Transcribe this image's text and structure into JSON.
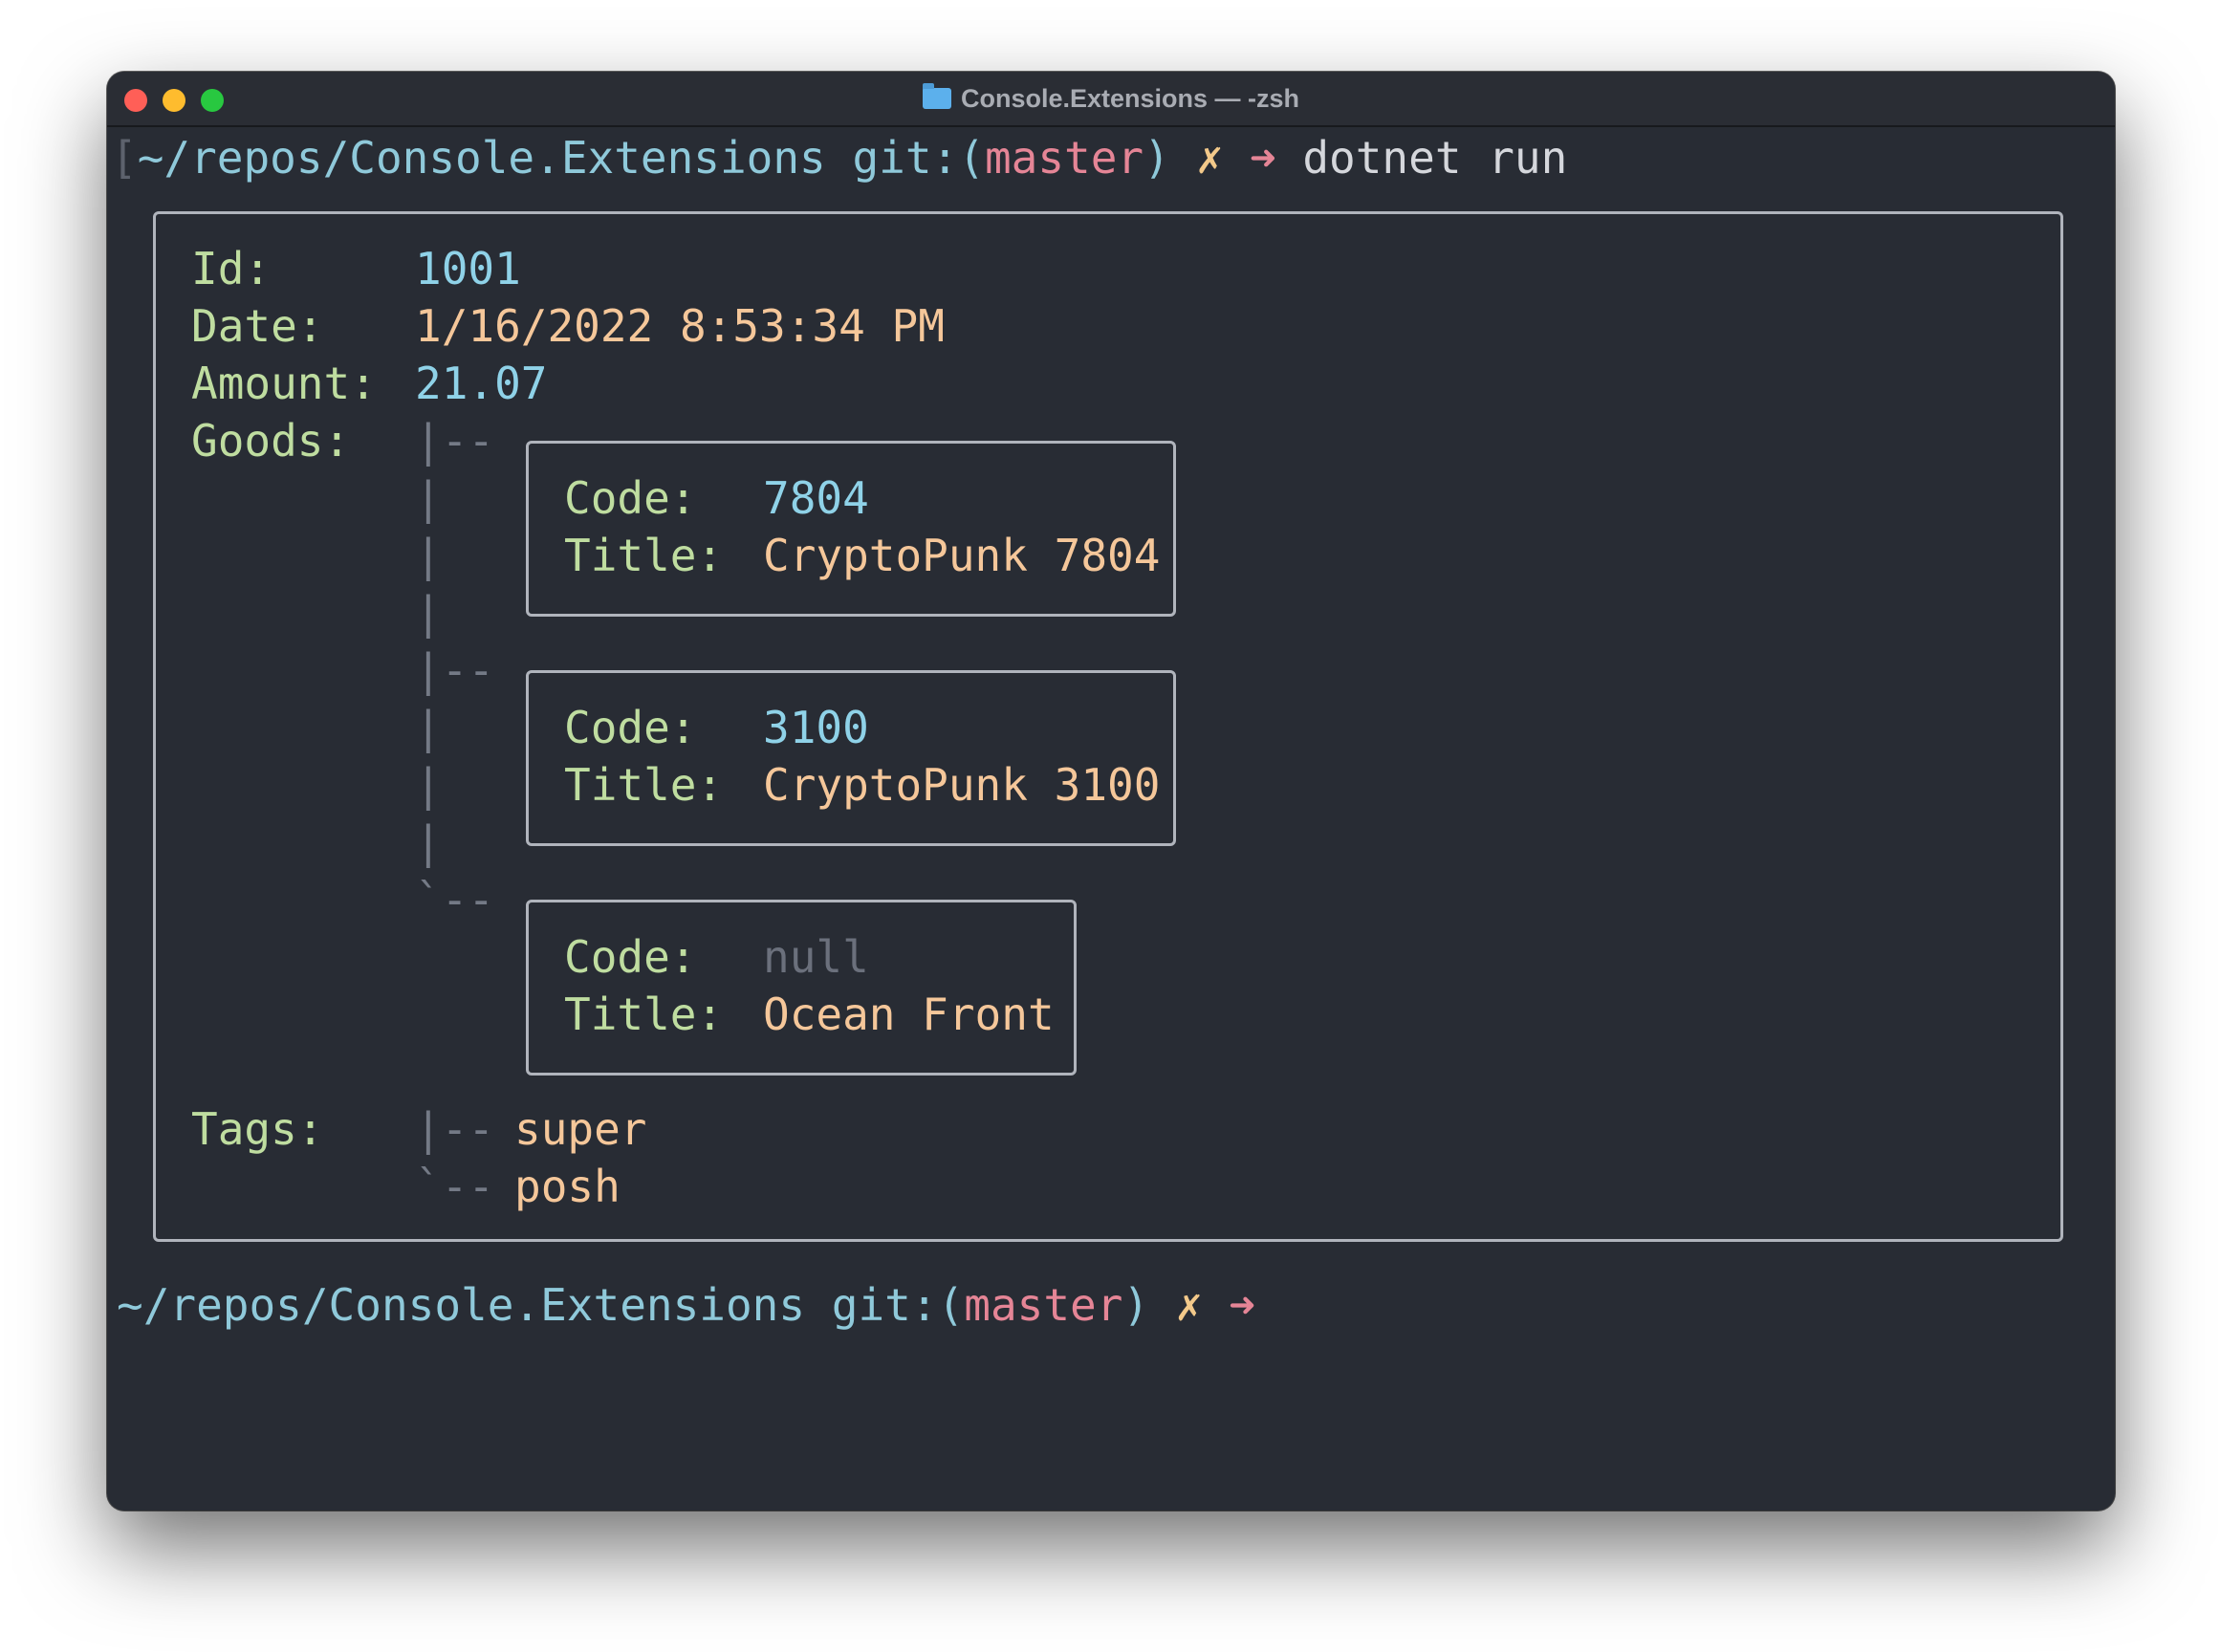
{
  "window": {
    "title": "Console.Extensions — -zsh"
  },
  "prompt": {
    "path": "~/repos/Console.Extensions",
    "git_prefix": "git:(",
    "branch": "master",
    "git_suffix": ")",
    "dirty_mark": "✗",
    "arrow": "➜",
    "command": "dotnet run"
  },
  "record": {
    "labels": {
      "id": "Id:",
      "date": "Date:",
      "amount": "Amount:",
      "goods": "Goods:",
      "tags": "Tags:"
    },
    "id": "1001",
    "date": "1/16/2022 8:53:34 PM",
    "amount": "21.07",
    "goods": [
      {
        "code_label": "Code:",
        "code": "7804",
        "title_label": "Title:",
        "title": "CryptoPunk 7804"
      },
      {
        "code_label": "Code:",
        "code": "3100",
        "title_label": "Title:",
        "title": "CryptoPunk 3100"
      },
      {
        "code_label": "Code:",
        "code": "null",
        "title_label": "Title:",
        "title": "Ocean Front"
      }
    ],
    "tags": [
      "super",
      "posh"
    ]
  },
  "tree": {
    "branch": "|--",
    "pipe": "|",
    "last": "`--"
  },
  "colors": {
    "background": "#282c34",
    "path": "#8fc9da",
    "branch": "#e58596",
    "label": "#bfdda0",
    "number": "#8fd2e8",
    "string": "#f5c79a",
    "null": "#6b707c"
  }
}
